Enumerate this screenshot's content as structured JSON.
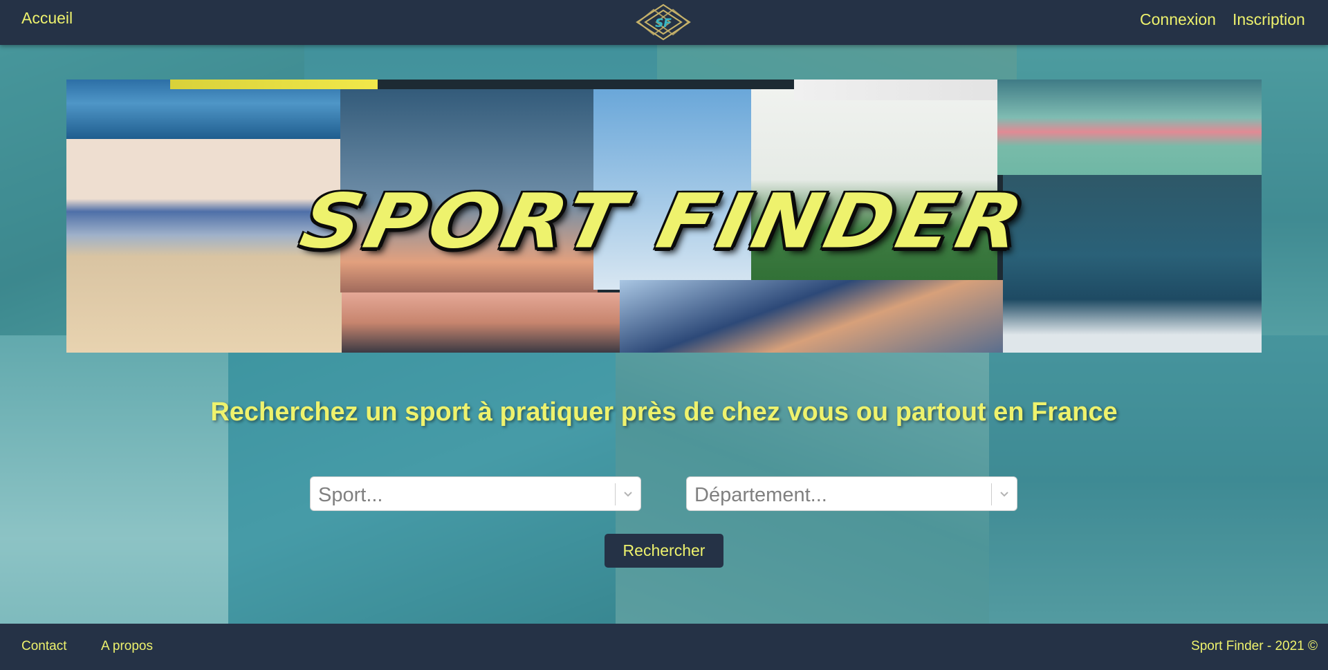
{
  "nav": {
    "home_label": "Accueil",
    "login_label": "Connexion",
    "register_label": "Inscription",
    "logo_text": "SF"
  },
  "hero": {
    "title": "SPORT FINDER"
  },
  "tagline": "Recherchez un sport à pratiquer près de chez vous ou partout en France",
  "search": {
    "sport_placeholder": "Sport...",
    "department_placeholder": "Département...",
    "button_label": "Rechercher"
  },
  "footer": {
    "contact_label": "Contact",
    "about_label": "A propos",
    "copyright": "Sport Finder - 2021 ©"
  },
  "colors": {
    "nav_bg": "#253246",
    "accent_yellow": "#eef26d",
    "teal_overlay": "#4eaaac"
  },
  "icons": {
    "logo": "sf-diamond-logo",
    "select_arrow": "chevron-down-icon"
  }
}
